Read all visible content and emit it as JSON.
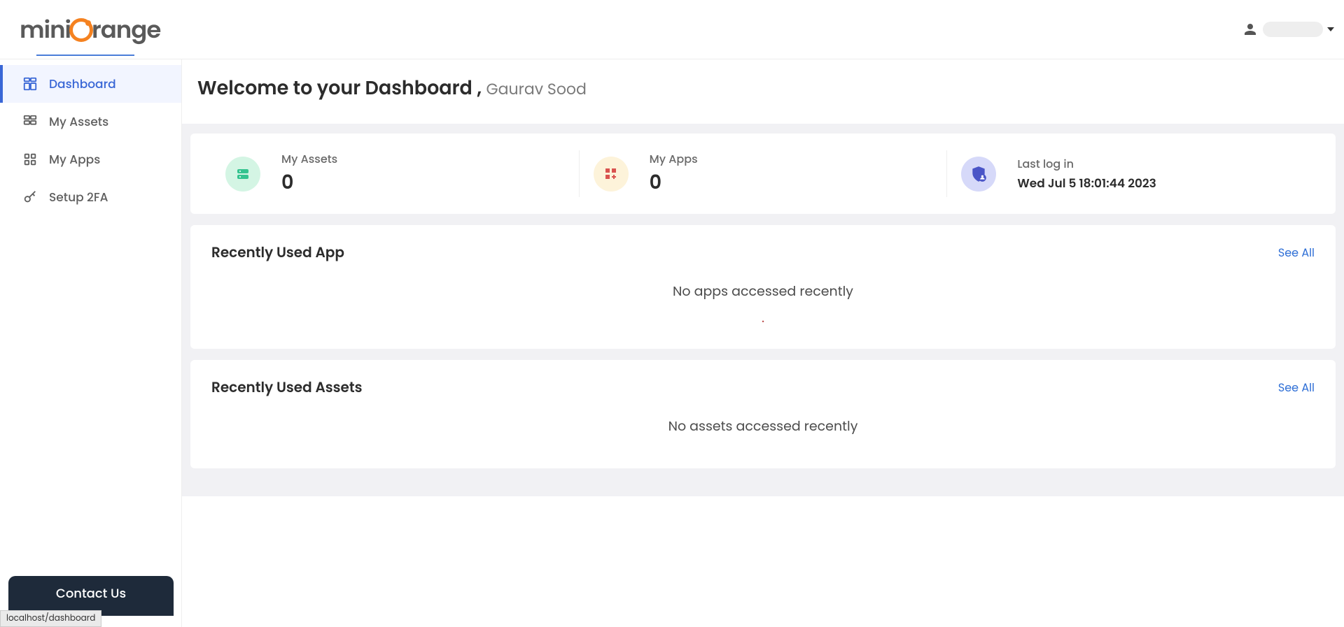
{
  "logo": {
    "part1": "mini",
    "part2": "range"
  },
  "sidebar": {
    "items": [
      {
        "label": "Dashboard"
      },
      {
        "label": "My Assets"
      },
      {
        "label": "My Apps"
      },
      {
        "label": "Setup 2FA"
      }
    ],
    "contact_label": "Contact Us"
  },
  "page": {
    "welcome_prefix": "Welcome to your Dashboard , ",
    "user_name": "Gaurav Sood"
  },
  "stats": {
    "assets": {
      "label": "My Assets",
      "value": "0"
    },
    "apps": {
      "label": "My Apps",
      "value": "0"
    },
    "lastlogin": {
      "label": "Last log in",
      "value": "Wed Jul 5 18:01:44 2023"
    }
  },
  "panels": {
    "apps": {
      "title": "Recently Used App",
      "see_all": "See All",
      "empty": "No apps accessed recently"
    },
    "assets": {
      "title": "Recently Used Assets",
      "see_all": "See All",
      "empty": "No assets accessed recently"
    }
  },
  "status_url": "localhost/dashboard"
}
